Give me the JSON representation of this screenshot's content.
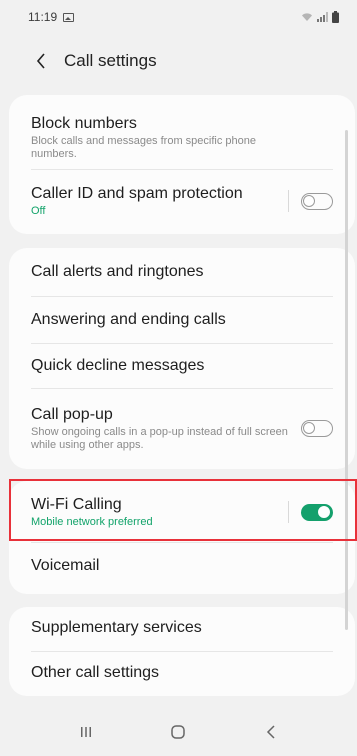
{
  "status_bar": {
    "time": "11:19"
  },
  "header": {
    "title": "Call settings"
  },
  "sections": [
    {
      "items": [
        {
          "title": "Block numbers",
          "subtitle": "Block calls and messages from specific phone numbers."
        },
        {
          "title": "Caller ID and spam protection",
          "subtitle": "Off",
          "toggle": false
        }
      ]
    },
    {
      "items": [
        {
          "title": "Call alerts and ringtones"
        },
        {
          "title": "Answering and ending calls"
        },
        {
          "title": "Quick decline messages"
        },
        {
          "title": "Call pop-up",
          "subtitle": "Show ongoing calls in a pop-up instead of full screen while using other apps.",
          "toggle": false
        }
      ]
    },
    {
      "items": [
        {
          "title": "Wi-Fi Calling",
          "subtitle": "Mobile network preferred",
          "toggle": true
        },
        {
          "title": "Voicemail"
        }
      ]
    },
    {
      "items": [
        {
          "title": "Supplementary services"
        },
        {
          "title": "Other call settings"
        }
      ]
    }
  ],
  "colors": {
    "accent": "#14a06c",
    "highlight": "#e8313a",
    "background": "#f1f1f1"
  },
  "icons": [
    "gallery-icon",
    "wifi-icon",
    "signal-icon",
    "battery-icon",
    "back-arrow-icon",
    "recents-icon",
    "home-icon",
    "back-icon"
  ]
}
